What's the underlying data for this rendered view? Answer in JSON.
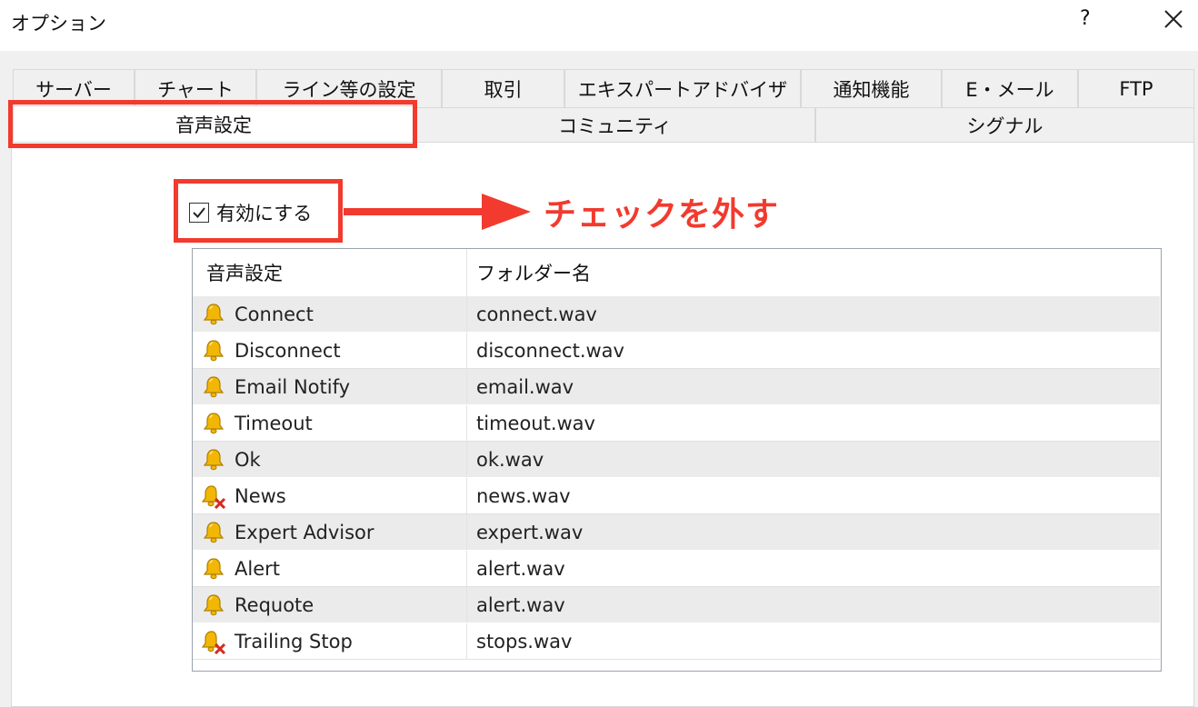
{
  "window": {
    "title": "オプション",
    "help": "?",
    "close_icon": "close-icon"
  },
  "tabs": {
    "row1": [
      "サーバー",
      "チャート",
      "ライン等の設定",
      "取引",
      "エキスパートアドバイザ",
      "通知機能",
      "E・メール",
      "FTP"
    ],
    "row2": [
      "音声設定",
      "コミュニティ",
      "シグナル"
    ],
    "selected": "音声設定"
  },
  "enable": {
    "label": "有効にする",
    "checked": true
  },
  "annotation": {
    "text": "チェックを外す",
    "color": "#f23a2e"
  },
  "table": {
    "headers": [
      "音声設定",
      "フォルダー名"
    ],
    "rows": [
      {
        "name": "Connect",
        "file": "connect.wav",
        "icon": "bell-icon"
      },
      {
        "name": "Disconnect",
        "file": "disconnect.wav",
        "icon": "bell-icon"
      },
      {
        "name": "Email Notify",
        "file": "email.wav",
        "icon": "bell-icon"
      },
      {
        "name": "Timeout",
        "file": "timeout.wav",
        "icon": "bell-icon"
      },
      {
        "name": "Ok",
        "file": "ok.wav",
        "icon": "bell-icon"
      },
      {
        "name": "News",
        "file": "news.wav",
        "icon": "bell-disabled-icon"
      },
      {
        "name": "Expert Advisor",
        "file": "expert.wav",
        "icon": "bell-icon"
      },
      {
        "name": "Alert",
        "file": "alert.wav",
        "icon": "bell-icon"
      },
      {
        "name": "Requote",
        "file": "alert.wav",
        "icon": "bell-icon"
      },
      {
        "name": "Trailing Stop",
        "file": "stops.wav",
        "icon": "bell-disabled-icon"
      }
    ]
  },
  "colors": {
    "highlight": "#f23a2e",
    "bell": "#f2b705"
  }
}
